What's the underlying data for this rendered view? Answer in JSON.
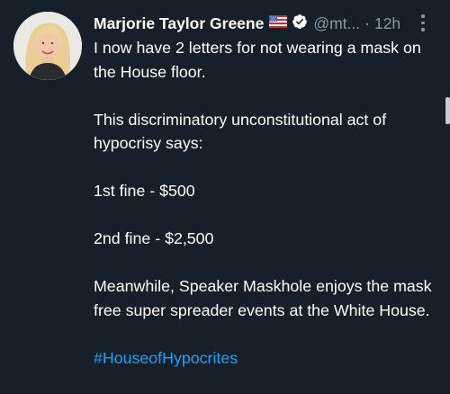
{
  "tweet": {
    "author_name": "Marjorie Taylor Greene",
    "handle": "@mt...",
    "separator": "·",
    "time": "12h",
    "paragraphs": [
      "I now have 2 letters for not wearing a mask on the House floor.",
      "This discriminatory unconstitutional act of hypocrisy says:",
      "1st fine - $500",
      "2nd fine - $2,500",
      "Meanwhile, Speaker Maskhole enjoys the mask free super spreader events at the White House."
    ],
    "hashtag": "#HouseofHypocrites"
  },
  "icons": {
    "flag": "us-flag-icon",
    "verified": "verified-badge-icon",
    "more": "more-vertical-icon"
  },
  "colors": {
    "background": "#15202b",
    "text": "#ffffff",
    "secondary_text": "#8899a6",
    "link": "#1da1f2"
  }
}
